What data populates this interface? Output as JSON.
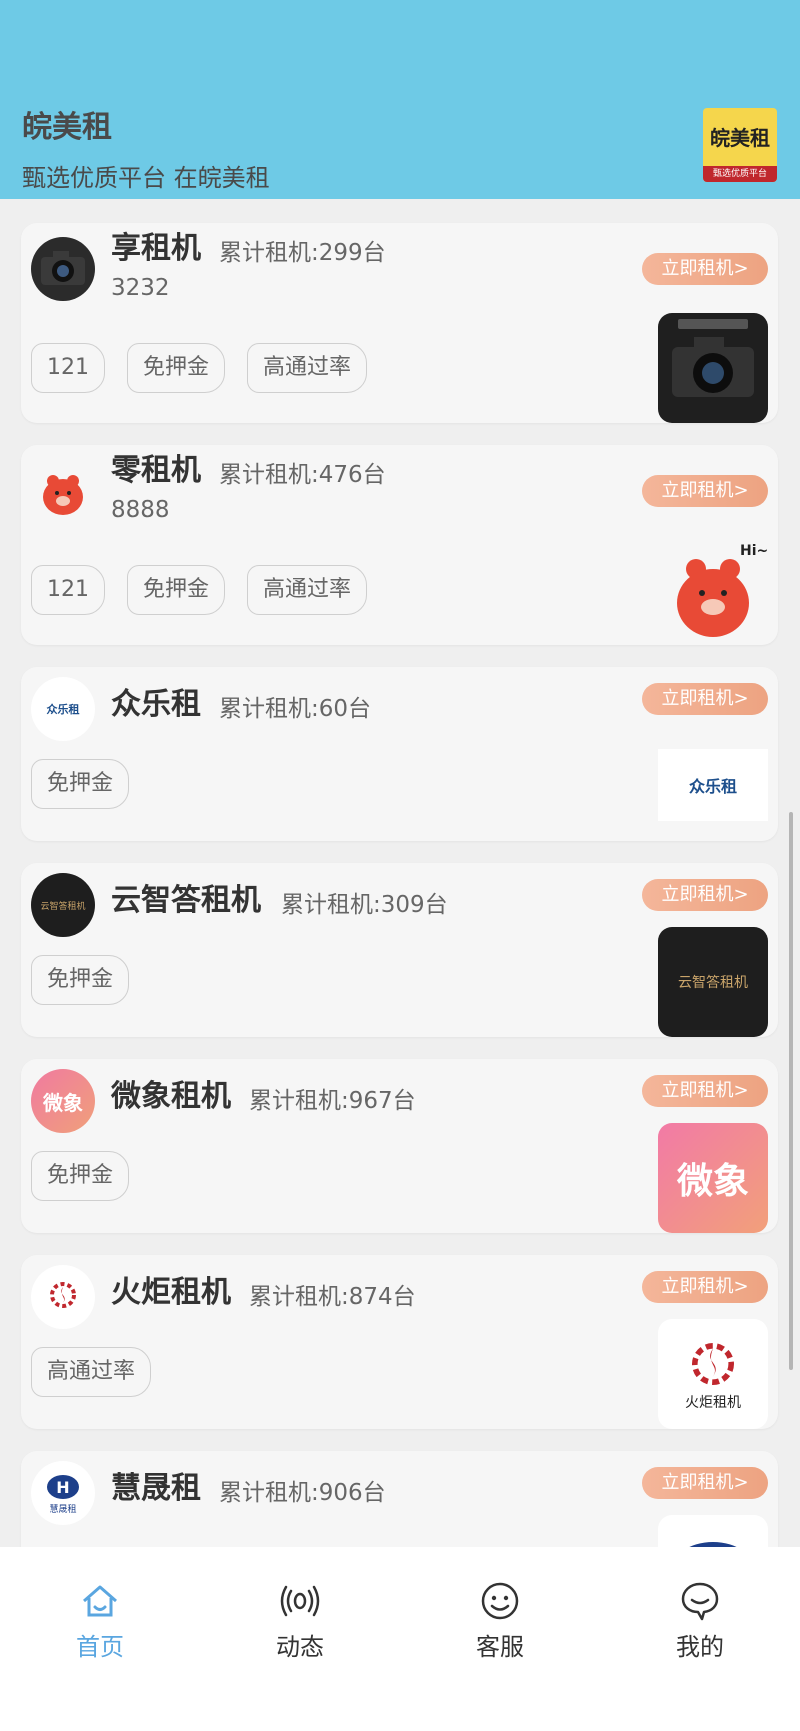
{
  "header": {
    "title": "皖美租",
    "subtitle": "甄选优质平台 在皖美租",
    "logo_text": "皖美租",
    "logo_caption": "甄选优质平台"
  },
  "colors": {
    "header_bg": "#6ecae6",
    "rent_button": "#eda381",
    "active_tab": "#5aa6e0"
  },
  "rent_label": "立即租机>",
  "cards": [
    {
      "name": "享租机",
      "count": "累计租机:299台",
      "desc": "3232",
      "tags": [
        "121",
        "免押金",
        "高通过率"
      ],
      "icon": "camera-icon"
    },
    {
      "name": "零租机",
      "count": "累计租机:476台",
      "desc": "8888",
      "tags": [
        "121",
        "免押金",
        "高通过率"
      ],
      "icon": "bear-mascot-icon"
    },
    {
      "name": "众乐租",
      "count": "累计租机:60台",
      "tags": [
        "免押金"
      ],
      "logo_text": "众乐租",
      "icon": "zhonglezu-logo"
    },
    {
      "name": "云智答租机",
      "count": "累计租机:309台",
      "tags": [
        "免押金"
      ],
      "logo_text": "云智答租机",
      "icon": "yunzhida-logo"
    },
    {
      "name": "微象租机",
      "count": "累计租机:967台",
      "tags": [
        "免押金"
      ],
      "logo_text": "微象",
      "icon": "weixiang-logo"
    },
    {
      "name": "火炬租机",
      "count": "累计租机:874台",
      "tags": [
        "高通过率"
      ],
      "logo_text": "火炬租机",
      "icon": "huoju-logo"
    },
    {
      "name": "慧晟租",
      "count": "累计租机:906台",
      "tags": [],
      "logo_text": "慧晟租",
      "icon": "huisheng-logo"
    }
  ],
  "tabbar": [
    {
      "label": "首页",
      "icon": "home-icon",
      "active": true
    },
    {
      "label": "动态",
      "icon": "broadcast-icon"
    },
    {
      "label": "客服",
      "icon": "smile-icon"
    },
    {
      "label": "我的",
      "icon": "user-chat-icon"
    }
  ]
}
